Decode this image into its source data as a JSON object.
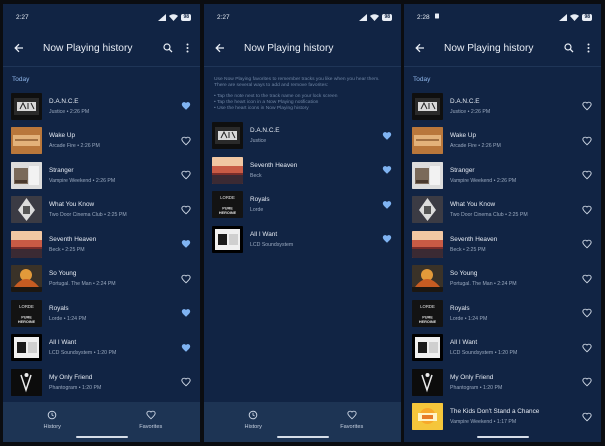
{
  "colors": {
    "background": "#112444",
    "heart_filled": "#7fb3f2",
    "heart_outline": "#cdd6e3",
    "accent": "#8fb6ea",
    "nav": "#1d3454"
  },
  "screens": [
    {
      "status": {
        "time": "2:27",
        "battery": "98"
      },
      "title": "Now Playing history",
      "section": "Today",
      "items": [
        {
          "title": "D.A.N.C.E",
          "meta": "Justice • 2:26 PM",
          "favorited": true,
          "art": "justice"
        },
        {
          "title": "Wake Up",
          "meta": "Arcade Fire • 2:26 PM",
          "favorited": false,
          "art": "funeral"
        },
        {
          "title": "Stranger",
          "meta": "Vampire Weekend • 2:26 PM",
          "favorited": false,
          "art": "vampire"
        },
        {
          "title": "What You Know",
          "meta": "Two Door Cinema Club • 2:25 PM",
          "favorited": false,
          "art": "tdcc"
        },
        {
          "title": "Seventh Heaven",
          "meta": "Beck • 2:25 PM",
          "favorited": true,
          "art": "beck"
        },
        {
          "title": "So Young",
          "meta": "Portugal. The Man • 2:24 PM",
          "favorited": false,
          "art": "portugal"
        },
        {
          "title": "Royals",
          "meta": "Lorde • 1:24 PM",
          "favorited": true,
          "art": "lorde"
        },
        {
          "title": "All I Want",
          "meta": "LCD Soundsystem • 1:20 PM",
          "favorited": true,
          "art": "lcd"
        },
        {
          "title": "My Only Friend",
          "meta": "Phantogram • 1:20 PM",
          "favorited": false,
          "art": "phantogram"
        }
      ]
    },
    {
      "status": {
        "time": "2:27",
        "battery": "98"
      },
      "title": "Now Playing history",
      "hint": [
        "Use Now Playing favorites to remember tracks you like when you hear them. There are several ways to add and remove favorites:",
        "• Tap the note next to the track name on your lock screen\n• Tap the heart icon in a Now Playing notification\n• Use the heart icons in Now Playing history"
      ],
      "items": [
        {
          "title": "D.A.N.C.E",
          "meta": "Justice",
          "favorited": true,
          "art": "justice"
        },
        {
          "title": "Seventh Heaven",
          "meta": "Beck",
          "favorited": true,
          "art": "beck"
        },
        {
          "title": "Royals",
          "meta": "Lorde",
          "favorited": true,
          "art": "lorde"
        },
        {
          "title": "All I Want",
          "meta": "LCD Soundsystem",
          "favorited": true,
          "art": "lcd"
        }
      ]
    },
    {
      "status": {
        "time": "2:28",
        "battery": "98"
      },
      "title": "Now Playing history",
      "section": "Today",
      "items": [
        {
          "title": "D.A.N.C.E",
          "meta": "Justice • 2:26 PM",
          "favorited": false,
          "art": "justice"
        },
        {
          "title": "Wake Up",
          "meta": "Arcade Fire • 2:26 PM",
          "favorited": false,
          "art": "funeral"
        },
        {
          "title": "Stranger",
          "meta": "Vampire Weekend • 2:26 PM",
          "favorited": false,
          "art": "vampire"
        },
        {
          "title": "What You Know",
          "meta": "Two Door Cinema Club • 2:25 PM",
          "favorited": false,
          "art": "tdcc"
        },
        {
          "title": "Seventh Heaven",
          "meta": "Beck • 2:25 PM",
          "favorited": false,
          "art": "beck"
        },
        {
          "title": "So Young",
          "meta": "Portugal. The Man • 2:24 PM",
          "favorited": false,
          "art": "portugal"
        },
        {
          "title": "Royals",
          "meta": "Lorde • 1:24 PM",
          "favorited": false,
          "art": "lorde"
        },
        {
          "title": "All I Want",
          "meta": "LCD Soundsystem • 1:20 PM",
          "favorited": false,
          "art": "lcd"
        },
        {
          "title": "My Only Friend",
          "meta": "Phantogram • 1:20 PM",
          "favorited": false,
          "art": "phantogram"
        },
        {
          "title": "The Kids Don't Stand a Chance",
          "meta": "Vampire Weekend • 1:17 PM",
          "favorited": false,
          "art": "vampire2"
        }
      ]
    }
  ],
  "nav": {
    "history_label": "History",
    "favorites_label": "Favorites"
  },
  "art_text": {
    "lorde_top": "LORDE",
    "lorde_mid": "PURE",
    "lorde_bot": "HEROINE"
  }
}
